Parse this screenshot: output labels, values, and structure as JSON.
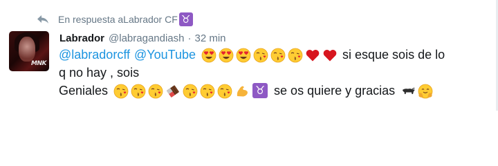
{
  "reply_context": {
    "text": "En respuesta a ",
    "handle": "Labrador CF",
    "sign_icon": "taurus-icon",
    "sign_glyph": "♉"
  },
  "avatar": {
    "icon": "profile-photo",
    "watermark": "MNK"
  },
  "author": {
    "name": "Labrador",
    "handle": "@labragandiash",
    "separator": "·",
    "time": "32 min"
  },
  "tweet": {
    "mention_1": "@labradorcff",
    "mention_2": "@YouTube",
    "text_1": "si esque sois de lo",
    "text_2": "q no hay , sois",
    "text_3": "Geniales",
    "text_4": "se os quiere y gracias",
    "taurus_glyph": "♉",
    "emojis_line1": [
      "heart-eyes-face",
      "heart-eyes-face",
      "heart-eyes-face",
      "kissing-face",
      "kissing-face",
      "kissing-face",
      "red-heart",
      "red-heart"
    ],
    "emojis_line3_a": [
      "kissing-face",
      "kissing-face",
      "kissing-face",
      "chocolate-bar",
      "kissing-face",
      "kissing-face",
      "kissing-face",
      "flexed-biceps"
    ],
    "emojis_line3_b": [
      "water-buffalo",
      "hugging-face"
    ]
  },
  "colors": {
    "link": "#1c94e0",
    "text": "#14171a",
    "secondary": "#657786",
    "taurus": "#8e59c4"
  }
}
